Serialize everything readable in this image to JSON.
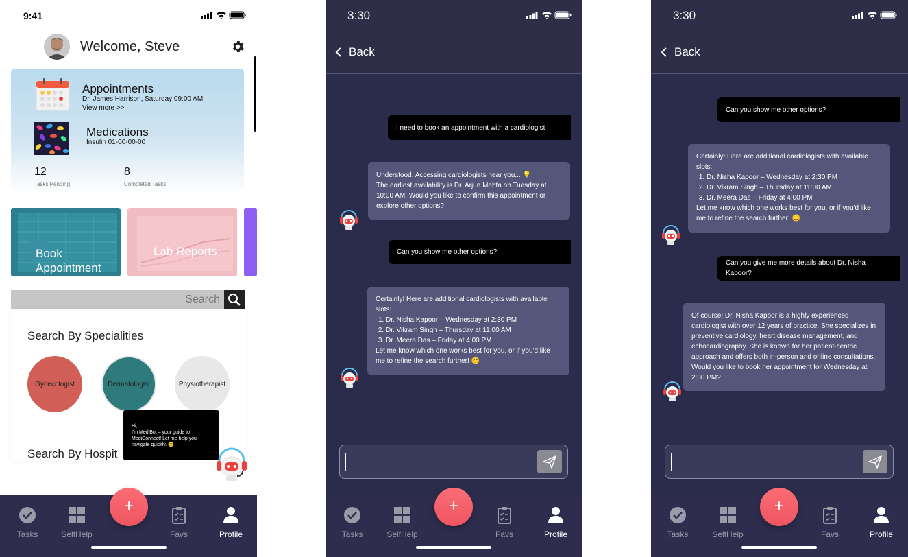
{
  "home": {
    "status_time": "9:41",
    "welcome": "Welcome, Steve",
    "appointments": {
      "title": "Appointments",
      "detail": "Dr. James Harrison, Saturday 09:00 AM",
      "view_more": "View more >>"
    },
    "medications": {
      "title": "Medications",
      "detail": "Insulin  01-00-00-00"
    },
    "stats": [
      {
        "value": "12",
        "label": "Tasks Pending"
      },
      {
        "value": "8",
        "label": "Completed Tasks"
      }
    ],
    "tiles": [
      "Book Appointment",
      "Lab Reports"
    ],
    "search_placeholder": "Search",
    "specialities_title": "Search By Specialities",
    "specialities": [
      "Gynecologist",
      "Dermatologist",
      "Physiotherapist"
    ],
    "hospitals_title": "Search By Hospit",
    "tooltip": "Hi,\nI'm MediBot – your guide to MediConnect! Let me help you navigate quickly. 😊"
  },
  "chat": {
    "status_time": "3:30",
    "back_label": "Back",
    "screen2": [
      {
        "from": "user",
        "text": "I need to book an appointment with a cardiologist"
      },
      {
        "from": "bot",
        "lines": [
          "Understood. Accessing cardiologists near you... 💡",
          "The earliest availability is Dr. Arjun Mehta on Tuesday at 10:00 AM. Would you like to confirm this appointment or explore other options?"
        ]
      },
      {
        "from": "user",
        "text": "Can you show me other options?"
      },
      {
        "from": "bot",
        "intro": "Certainly! Here are additional cardiologists with available slots:",
        "list": [
          "Dr. Nisha Kapoor – Wednesday at 2:30 PM",
          "Dr. Vikram Singh – Thursday at 11:00 AM",
          "Dr. Meera Das – Friday at 4:00 PM"
        ],
        "outro": "Let me know which one works best for you, or if you'd like me to refine the search further! 😊"
      }
    ],
    "screen3": [
      {
        "from": "user",
        "text": "Can you show me other options?"
      },
      {
        "from": "bot",
        "intro": "Certainly! Here are additional cardiologists with available slots:",
        "list": [
          "Dr. Nisha Kapoor – Wednesday at 2:30 PM",
          "Dr. Vikram Singh – Thursday at 11:00 AM",
          "Dr. Meera Das – Friday at 4:00 PM"
        ],
        "outro": "Let me know which one works best for you, or if you'd like me to refine the search further! 😊"
      },
      {
        "from": "user",
        "text": "Can you give me more details about Dr. Nisha Kapoor?"
      },
      {
        "from": "bot",
        "lines": [
          "Of course! Dr. Nisha Kapoor is a highly experienced cardiologist with over 12 years of practice. She specializes in preventive cardiology, heart disease management, and echocardiography. She is known for her patient-centric approach and offers both in-person and online consultations. Would you like to book her appointment for Wednesday at 2:30 PM?"
        ]
      }
    ]
  },
  "nav": {
    "items": [
      {
        "label": "Tasks",
        "icon": "check-circle-icon"
      },
      {
        "label": "SelfHelp",
        "icon": "grid-icon"
      },
      {
        "label": "Favs",
        "icon": "clipboard-icon"
      },
      {
        "label": "Profile",
        "icon": "user-icon"
      }
    ],
    "fab_label": "+"
  },
  "colors": {
    "nav_bg": "#2e2d4d",
    "chat_bg": "#2b2b4b",
    "fab": "#f2626b",
    "bot_bubble": "#55577a",
    "user_bubble": "#000000"
  }
}
